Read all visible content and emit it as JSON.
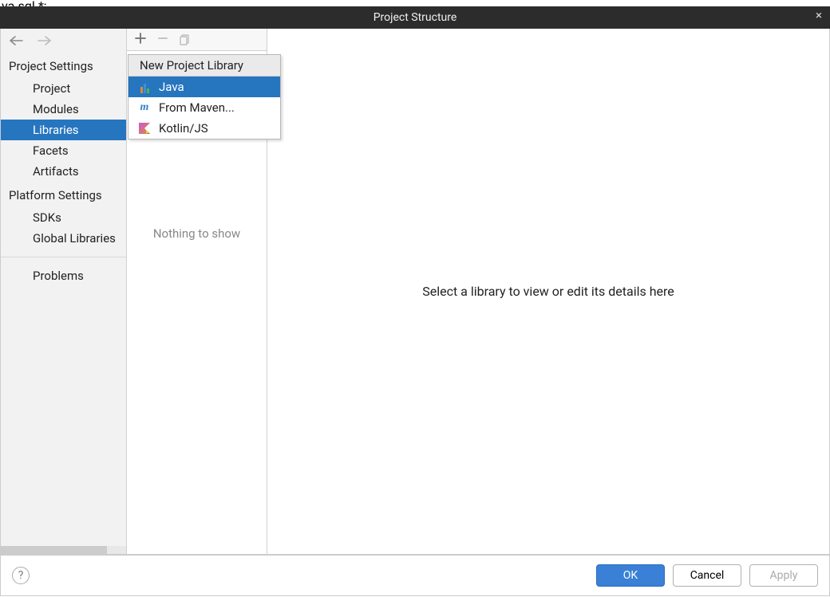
{
  "top_fragment": "va.sql.*;",
  "titlebar": {
    "title": "Project Structure"
  },
  "sidebar": {
    "project_settings_label": "Project Settings",
    "project_items": [
      "Project",
      "Modules",
      "Libraries",
      "Facets",
      "Artifacts"
    ],
    "selected_project_item_index": 2,
    "platform_settings_label": "Platform Settings",
    "platform_items": [
      "SDKs",
      "Global Libraries"
    ],
    "problems_label": "Problems"
  },
  "middle": {
    "empty_text": "Nothing to show"
  },
  "main": {
    "placeholder": "Select a library to view or edit its details here"
  },
  "footer": {
    "ok": "OK",
    "cancel": "Cancel",
    "apply": "Apply"
  },
  "popup": {
    "header": "New Project Library",
    "items": [
      {
        "label": "Java",
        "icon": "java"
      },
      {
        "label": "From Maven...",
        "icon": "maven"
      },
      {
        "label": "Kotlin/JS",
        "icon": "kotlin"
      }
    ],
    "selected_index": 0
  }
}
